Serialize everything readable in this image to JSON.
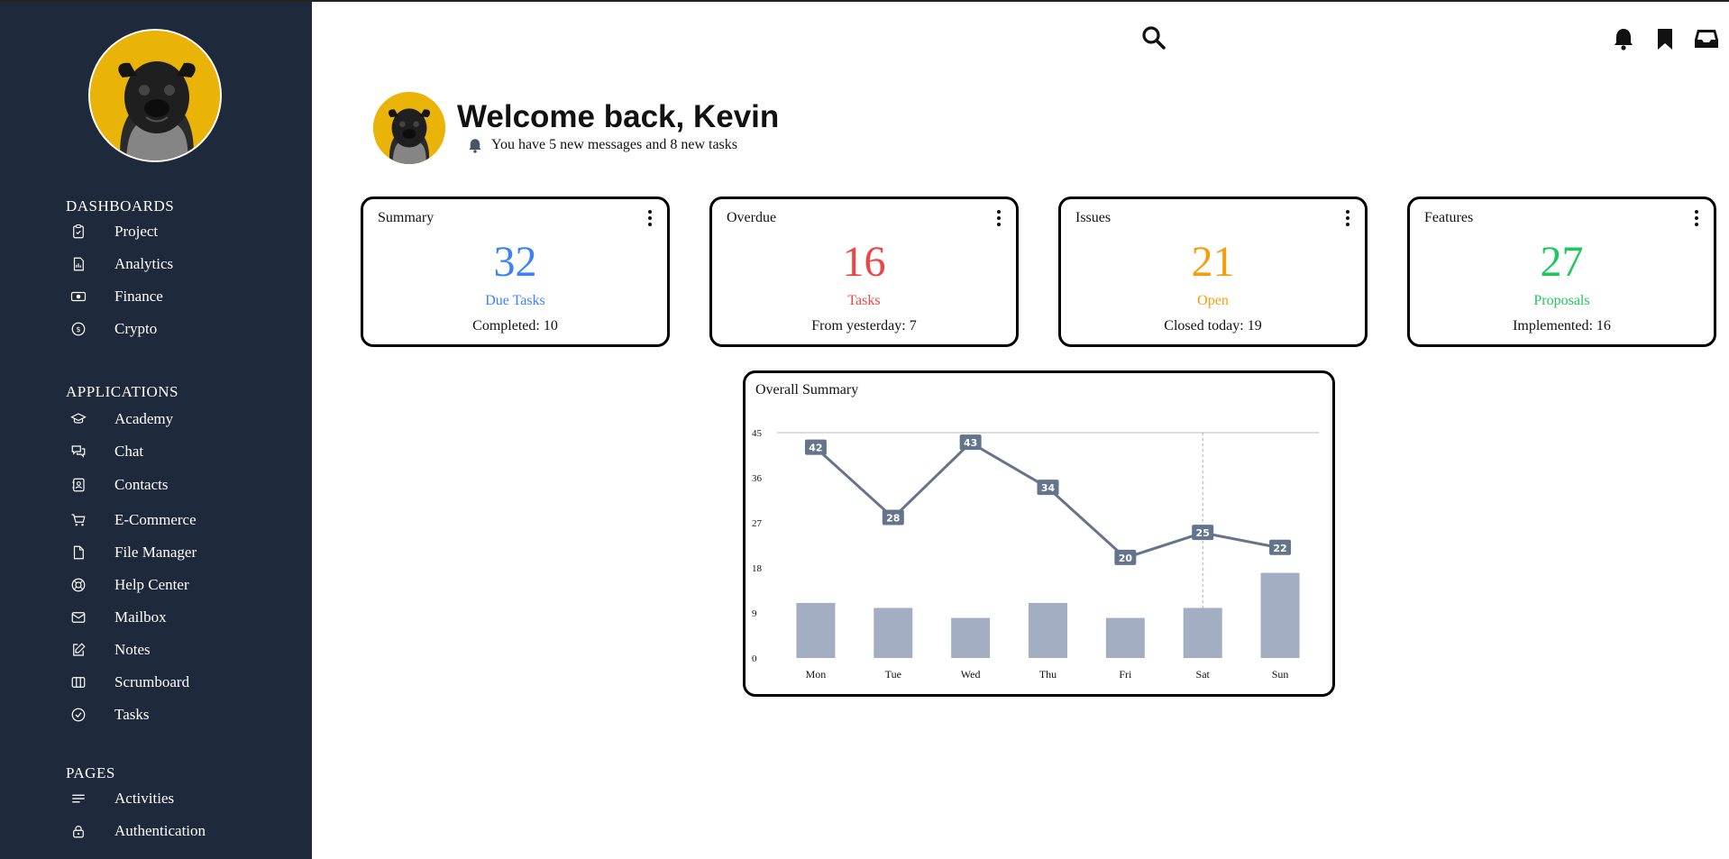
{
  "sidebar": {
    "sections": [
      {
        "title": "DASHBOARDS",
        "items": [
          {
            "label": "Project",
            "icon": "clipboard-check-icon"
          },
          {
            "label": "Analytics",
            "icon": "chart-document-icon"
          },
          {
            "label": "Finance",
            "icon": "banknote-icon"
          },
          {
            "label": "Crypto",
            "icon": "currency-coin-icon"
          }
        ]
      },
      {
        "title": "APPLICATIONS",
        "items": [
          {
            "label": "Academy",
            "icon": "graduation-cap-icon"
          },
          {
            "label": "Chat",
            "icon": "chat-bubbles-icon"
          },
          {
            "label": "Contacts",
            "icon": "contact-book-icon"
          },
          {
            "label": "E-Commerce",
            "icon": "shopping-cart-icon"
          },
          {
            "label": "File Manager",
            "icon": "document-icon"
          },
          {
            "label": "Help Center",
            "icon": "lifebuoy-icon"
          },
          {
            "label": "Mailbox",
            "icon": "envelope-icon"
          },
          {
            "label": "Notes",
            "icon": "pencil-square-icon"
          },
          {
            "label": "Scrumboard",
            "icon": "columns-board-icon"
          },
          {
            "label": "Tasks",
            "icon": "check-circle-icon"
          }
        ]
      },
      {
        "title": "PAGES",
        "items": [
          {
            "label": "Activities",
            "icon": "lines-icon"
          },
          {
            "label": "Authentication",
            "icon": "lock-icon"
          }
        ]
      }
    ]
  },
  "header": {
    "icons": [
      "search-icon",
      "bell-icon",
      "bookmark-icon",
      "inbox-icon"
    ]
  },
  "welcome": {
    "title": "Welcome back, Kevin",
    "subtitle": "You have 5 new messages and 8 new tasks"
  },
  "cards": [
    {
      "title": "Summary",
      "value": "32",
      "label": "Due Tasks",
      "footer": "Completed: 10",
      "color": "#3b82f6"
    },
    {
      "title": "Overdue",
      "value": "16",
      "label": "Tasks",
      "footer": "From yesterday: 7",
      "color": "#ef4444"
    },
    {
      "title": "Issues",
      "value": "21",
      "label": "Open",
      "footer": "Closed today: 19",
      "color": "#f59e0b"
    },
    {
      "title": "Features",
      "value": "27",
      "label": "Proposals",
      "footer": "Implemented: 16",
      "color": "#22c55e"
    }
  ],
  "chart_card": {
    "title": "Overall Summary"
  },
  "chart_data": {
    "type": "bar",
    "title": "Overall Summary",
    "categories": [
      "Mon",
      "Tue",
      "Wed",
      "Thu",
      "Fri",
      "Sat",
      "Sun"
    ],
    "ylim": [
      0,
      45
    ],
    "yticks": [
      "45",
      "36",
      "27",
      "18",
      "9",
      "0"
    ],
    "series": [
      {
        "type": "line",
        "values": [
          42,
          28,
          43,
          34,
          20,
          25,
          22
        ],
        "color": "#64748b"
      },
      {
        "type": "bar",
        "values": [
          11,
          10,
          8,
          11,
          8,
          10,
          17
        ],
        "color": "#a3aec2"
      }
    ],
    "highlight_category": "Sat",
    "legend": "none",
    "grid": false
  },
  "colors": {
    "sidebar_bg": "#1e293b",
    "avatar_bg": "#eab308"
  }
}
